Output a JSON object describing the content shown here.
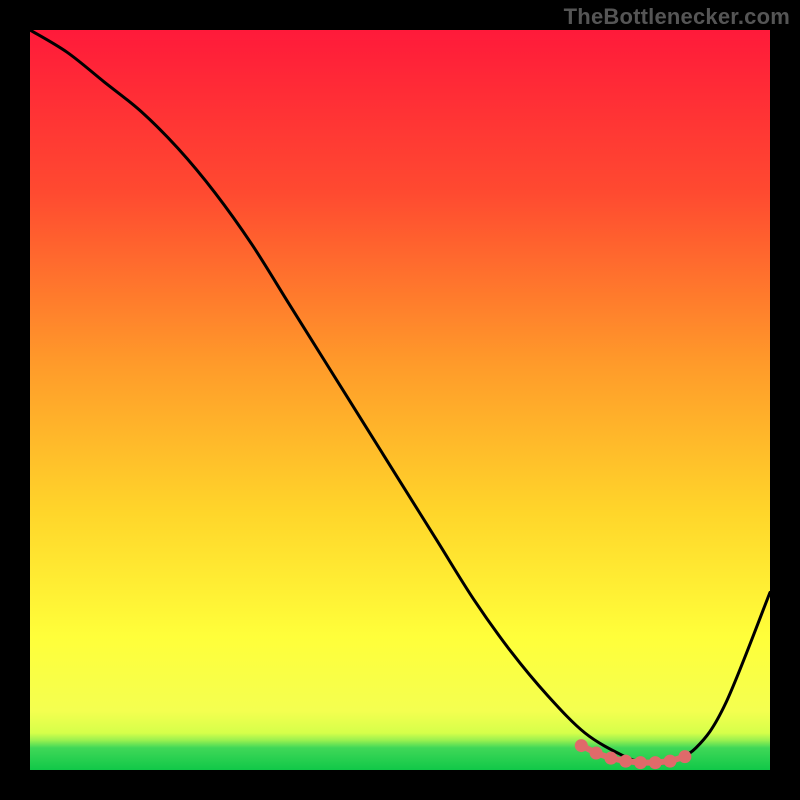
{
  "watermark": "TheBottlenecker.com",
  "chart_data": {
    "type": "line",
    "title": "",
    "xlabel": "",
    "ylabel": "",
    "xlim": [
      0,
      100
    ],
    "ylim": [
      0,
      100
    ],
    "grid": false,
    "legend": false,
    "background_gradient": {
      "top": "#ff1a3a",
      "mid_upper": "#ff6a2a",
      "mid": "#ffc92a",
      "mid_lower": "#ffff3a",
      "green_band": "#1fe05a",
      "bottom": "#0fc84a"
    },
    "series": [
      {
        "name": "bottleneck-curve",
        "color": "#000000",
        "x": [
          0,
          5,
          10,
          15,
          20,
          25,
          30,
          35,
          40,
          45,
          50,
          55,
          60,
          65,
          70,
          75,
          80,
          83,
          86,
          90,
          94,
          100
        ],
        "y": [
          100,
          97,
          93,
          89,
          84,
          78,
          71,
          63,
          55,
          47,
          39,
          31,
          23,
          16,
          10,
          5,
          2,
          1,
          1,
          3,
          9,
          24
        ]
      }
    ],
    "markers": {
      "name": "trough-markers",
      "color": "#e06a6a",
      "x": [
        74.5,
        76.5,
        78.5,
        80.5,
        82.5,
        84.5,
        86.5,
        88.5
      ],
      "y": [
        3.3,
        2.3,
        1.6,
        1.2,
        1.0,
        1.0,
        1.2,
        1.8
      ]
    }
  }
}
